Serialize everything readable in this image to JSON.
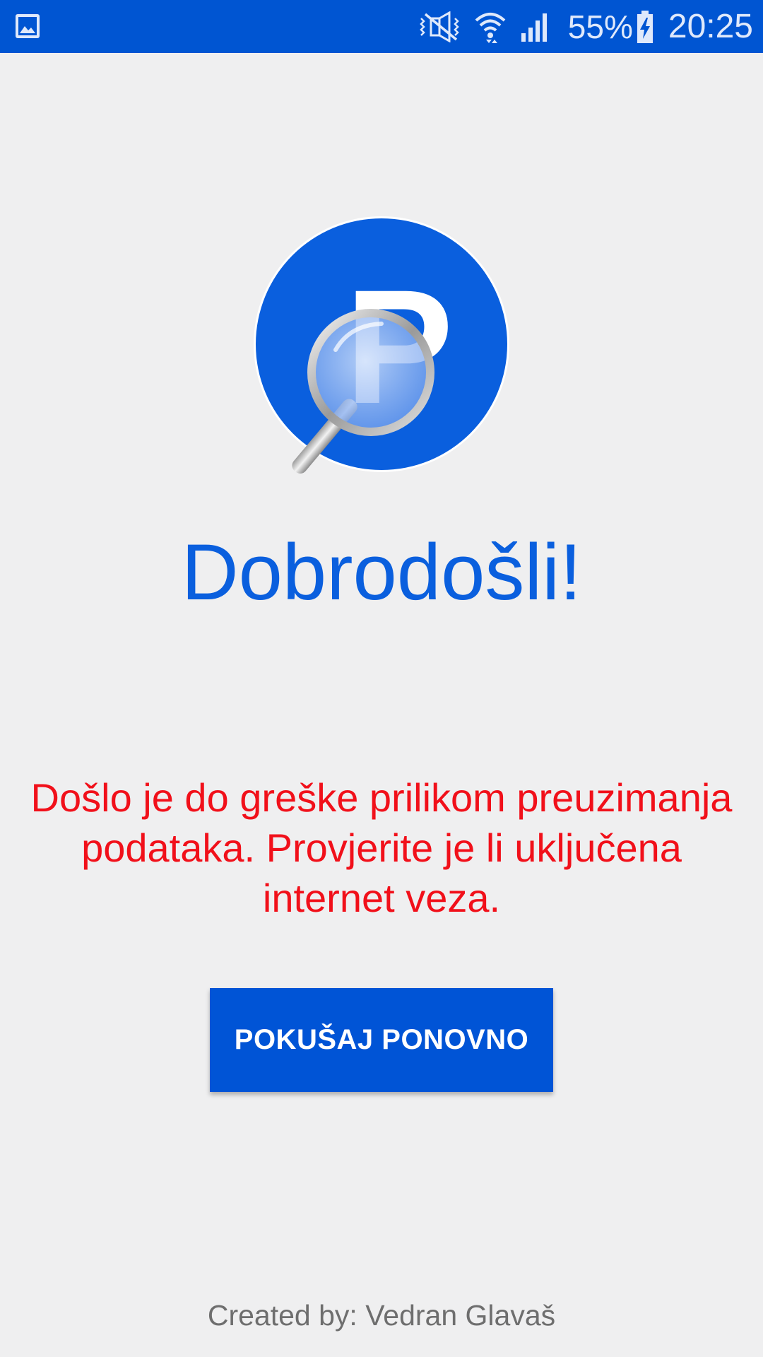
{
  "status_bar": {
    "battery_percent": "55%",
    "time": "20:25",
    "icons": [
      "gallery-icon",
      "mute-icon",
      "wifi-icon",
      "signal-icon",
      "battery-charging-icon"
    ],
    "background_color": "#0055d2"
  },
  "logo": {
    "letter": "P",
    "icon": "parking-search-logo",
    "color": "#0a5fde"
  },
  "main": {
    "welcome": "Dobrodošli!",
    "error_message": "Došlo je do greške prilikom preuzimanja podataka. Provjerite je li uključena internet veza.",
    "retry_label": "POKUŠAJ PONOVNO"
  },
  "footer": {
    "credit": "Created by: Vedran Glavaš"
  },
  "colors": {
    "accent": "#0055d2",
    "error": "#f1101a",
    "background": "#efeff0"
  }
}
